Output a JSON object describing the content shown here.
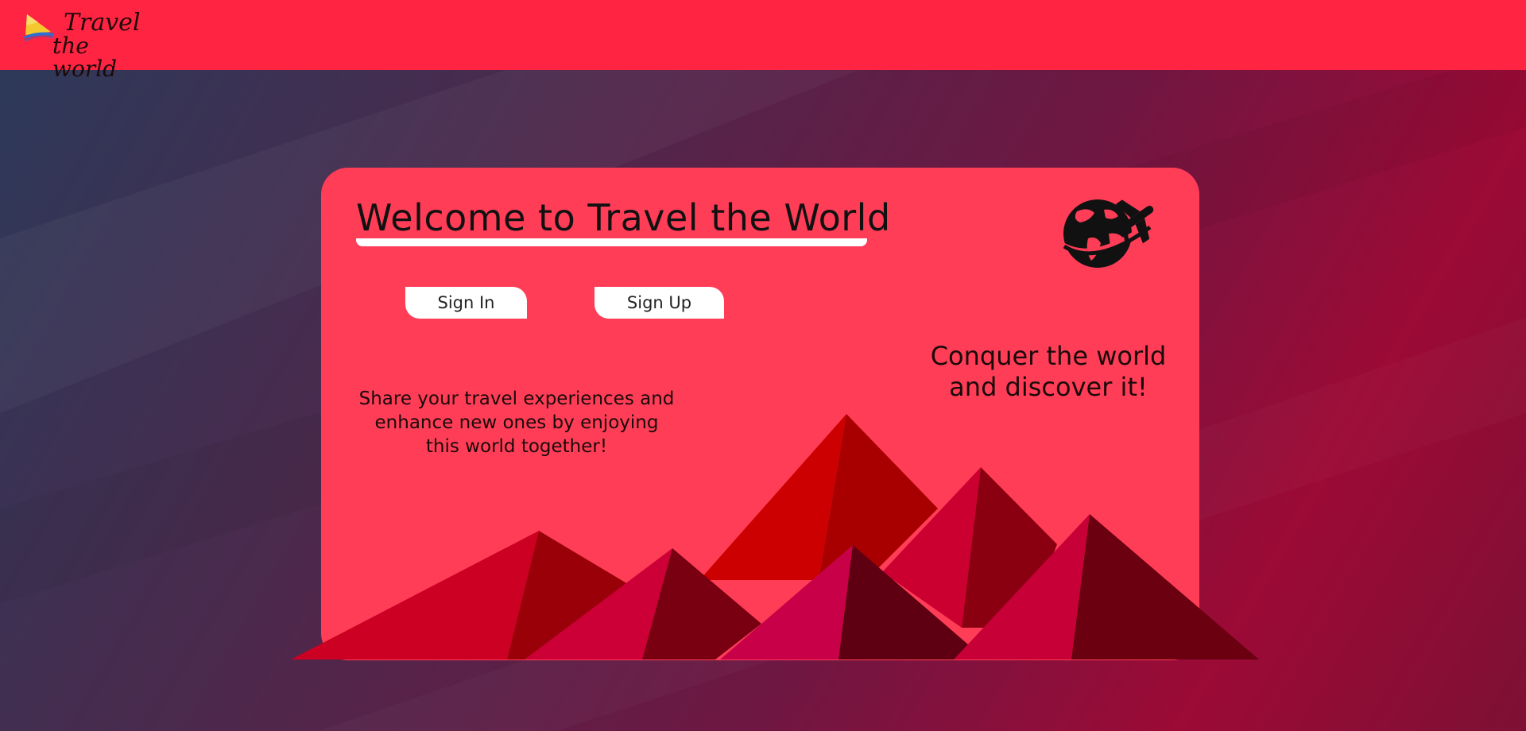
{
  "logo": {
    "line1": "Travel",
    "line2": "the world",
    "icon": "sail-boat-icon"
  },
  "card": {
    "title": "Welcome to Travel the World",
    "signin_label": "Sign In",
    "signup_label": "Sign Up",
    "tagline_right": "Conquer the world and discover it!",
    "tagline_left": "Share your travel experiences and enhance new ones by enjoying this world together!",
    "globe_icon": "globe-airplane-icon"
  },
  "colors": {
    "topbar": "#ff2442",
    "card": "#ff3d57",
    "button": "#ffffff",
    "mountain_red": "#cc0000",
    "mountain_crimson": "#cc0033",
    "mountain_dark": "#6e0014"
  }
}
